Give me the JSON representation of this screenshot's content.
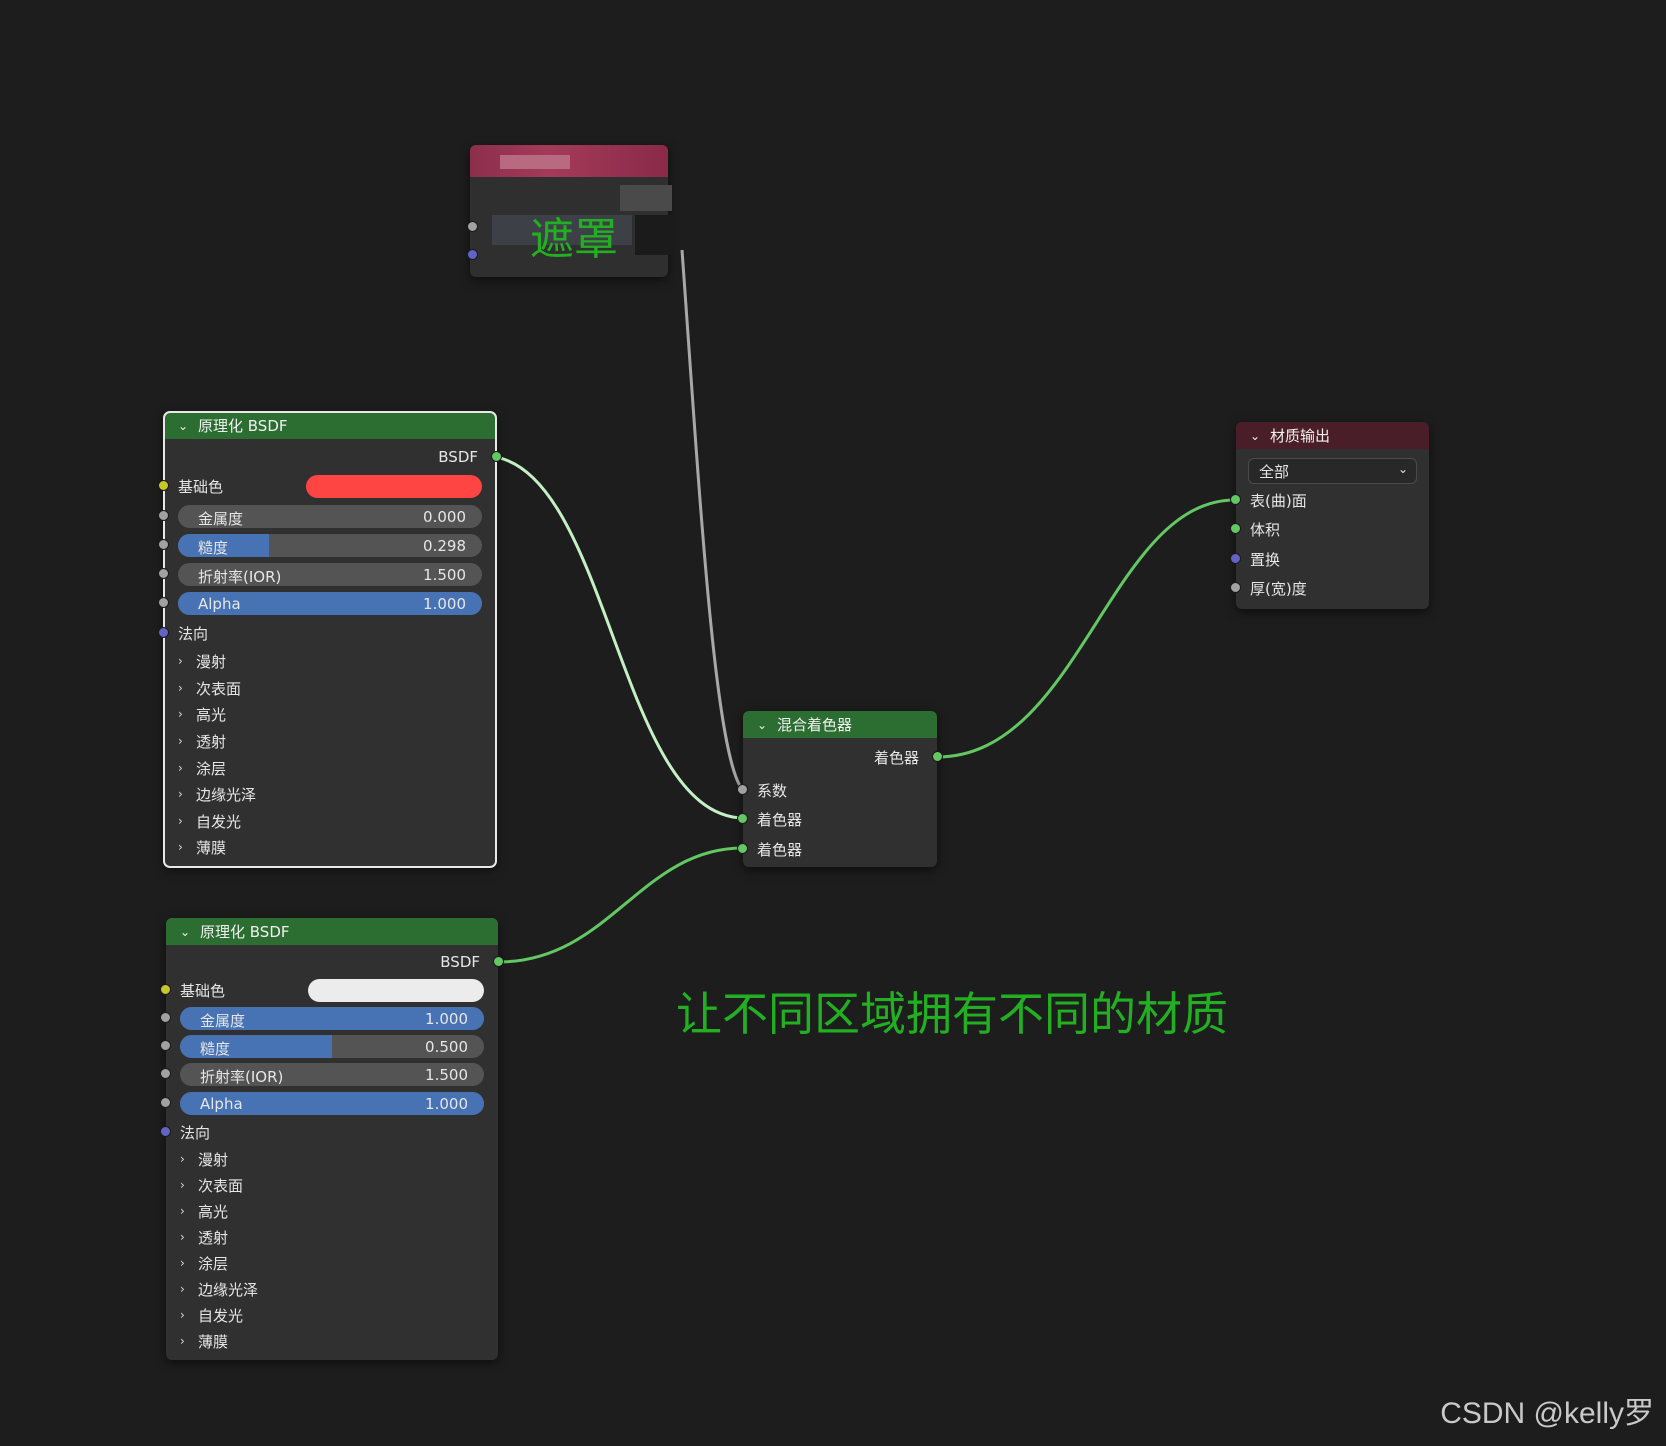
{
  "mask_node": {
    "label": "遮罩"
  },
  "bsdf_1": {
    "title": "原理化 BSDF",
    "output": "BSDF",
    "base_color_label": "基础色",
    "base_color": "#ff4444",
    "metallic": {
      "label": "金属度",
      "value": "0.000",
      "fraction": 0.0
    },
    "roughness": {
      "label": "糙度",
      "value": "0.298",
      "fraction": 0.298
    },
    "ior": {
      "label": "折射率(IOR)",
      "value": "1.500",
      "fraction": 0.0
    },
    "alpha": {
      "label": "Alpha",
      "value": "1.000",
      "fraction": 1.0
    },
    "normal_label": "法向",
    "panels": [
      "漫射",
      "次表面",
      "高光",
      "透射",
      "涂层",
      "边缘光泽",
      "自发光",
      "薄膜"
    ]
  },
  "bsdf_2": {
    "title": "原理化 BSDF",
    "output": "BSDF",
    "base_color_label": "基础色",
    "base_color": "#ececec",
    "metallic": {
      "label": "金属度",
      "value": "1.000",
      "fraction": 1.0
    },
    "roughness": {
      "label": "糙度",
      "value": "0.500",
      "fraction": 0.5
    },
    "ior": {
      "label": "折射率(IOR)",
      "value": "1.500",
      "fraction": 0.0
    },
    "alpha": {
      "label": "Alpha",
      "value": "1.000",
      "fraction": 1.0
    },
    "normal_label": "法向",
    "panels": [
      "漫射",
      "次表面",
      "高光",
      "透射",
      "涂层",
      "边缘光泽",
      "自发光",
      "薄膜"
    ]
  },
  "mix_shader": {
    "title": "混合着色器",
    "output": "着色器",
    "inputs": [
      "系数",
      "着色器",
      "着色器"
    ]
  },
  "material_output": {
    "title": "材质输出",
    "target": "全部",
    "inputs": [
      "表(曲)面",
      "体积",
      "置换",
      "厚(宽)度"
    ]
  },
  "annotation": "让不同区域拥有不同的材质",
  "watermark": "CSDN @kelly罗",
  "colors": {
    "background": "#1d1d1d",
    "node_body": "#303030",
    "shader_header": "#2c6e31",
    "output_header": "#4a1e28",
    "slider_fill": "#4772b3",
    "shader_socket": "#63c763",
    "float_socket": "#a1a1a1",
    "color_socket": "#c7c729",
    "vector_socket": "#6363c7",
    "annotation_text": "#22b022"
  },
  "icons": {
    "collapse": "chevron-down-icon",
    "panel": "chevron-right-icon",
    "dropdown": "chevron-down-icon"
  }
}
